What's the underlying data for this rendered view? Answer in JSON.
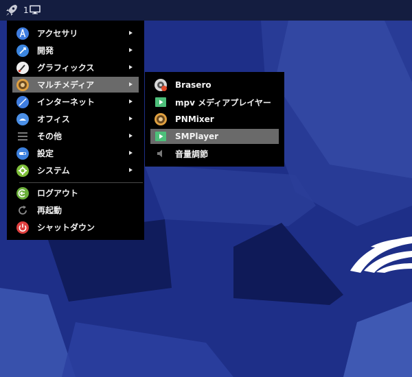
{
  "panel": {
    "workspace_number": "1",
    "launcher_icon": "rocket-icon",
    "workspace_icon": "monitor-icon"
  },
  "colors": {
    "panel_bg": "#141d40",
    "menu_bg": "#000000",
    "highlight": "#6a6a6a",
    "desktop_bg": "#1d2f86"
  },
  "main_menu": {
    "items": [
      {
        "label": "アクセサリ",
        "icon": "accessories-icon",
        "has_submenu": true
      },
      {
        "label": "開発",
        "icon": "development-icon",
        "has_submenu": true
      },
      {
        "label": "グラフィックス",
        "icon": "graphics-icon",
        "has_submenu": true
      },
      {
        "label": "マルチメディア",
        "icon": "multimedia-icon",
        "has_submenu": true,
        "highlighted": true
      },
      {
        "label": "インターネット",
        "icon": "internet-icon",
        "has_submenu": true
      },
      {
        "label": "オフィス",
        "icon": "office-icon",
        "has_submenu": true
      },
      {
        "label": "その他",
        "icon": "other-icon",
        "has_submenu": true
      },
      {
        "label": "設定",
        "icon": "settings-icon",
        "has_submenu": true
      },
      {
        "label": "システム",
        "icon": "system-icon",
        "has_submenu": true
      }
    ],
    "session_items": [
      {
        "label": "ログアウト",
        "icon": "logout-icon"
      },
      {
        "label": "再起動",
        "icon": "reboot-icon"
      },
      {
        "label": "シャットダウン",
        "icon": "shutdown-icon"
      }
    ]
  },
  "submenu": {
    "items": [
      {
        "label": "Brasero",
        "icon": "brasero-icon"
      },
      {
        "label": "mpv メディアプレイヤー",
        "icon": "mpv-icon"
      },
      {
        "label": "PNMixer",
        "icon": "pnmixer-icon"
      },
      {
        "label": "SMPlayer",
        "icon": "smplayer-icon",
        "highlighted": true
      },
      {
        "label": "音量調節",
        "icon": "volume-icon"
      }
    ]
  }
}
